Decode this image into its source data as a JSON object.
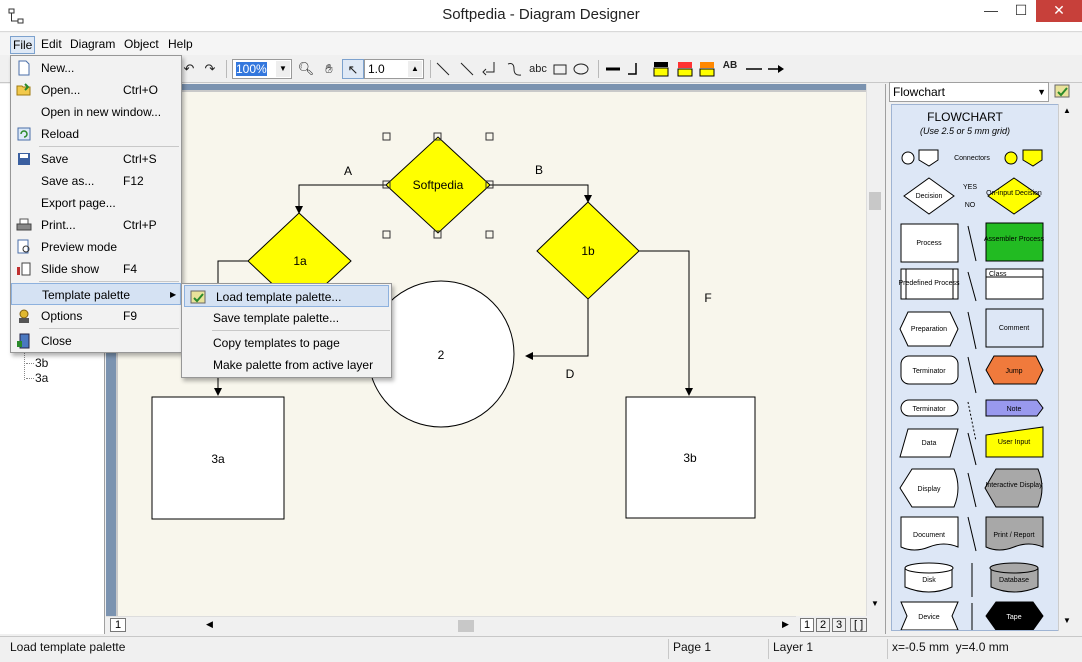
{
  "window": {
    "title": "Softpedia - Diagram Designer",
    "minimize_glyph": "—",
    "maximize_glyph": "☐",
    "close_glyph": "✕"
  },
  "menubar": {
    "items": [
      "File",
      "Edit",
      "Diagram",
      "Object",
      "Help"
    ]
  },
  "toolbar": {
    "zoom_value": "100%",
    "line_width_value": "1.0",
    "text_tool": "abc",
    "font_tool": "AB"
  },
  "file_menu": {
    "items": [
      {
        "label": "New...",
        "shortcut": "",
        "icon": "new-document-icon"
      },
      {
        "label": "Open...",
        "shortcut": "Ctrl+O",
        "icon": "open-folder-icon"
      },
      {
        "label": "Open in new window...",
        "shortcut": "",
        "icon": ""
      },
      {
        "label": "Reload",
        "shortcut": "",
        "icon": "reload-icon"
      },
      {
        "label": "Save",
        "shortcut": "Ctrl+S",
        "icon": "save-icon"
      },
      {
        "label": "Save as...",
        "shortcut": "F12",
        "icon": ""
      },
      {
        "label": "Export page...",
        "shortcut": "",
        "icon": ""
      },
      {
        "label": "Print...",
        "shortcut": "Ctrl+P",
        "icon": "print-icon"
      },
      {
        "label": "Preview mode",
        "shortcut": "",
        "icon": "preview-icon"
      },
      {
        "label": "Slide show",
        "shortcut": "F4",
        "icon": "slideshow-icon"
      },
      {
        "label": "Template palette",
        "shortcut": "",
        "icon": ""
      },
      {
        "label": "Options",
        "shortcut": "F9",
        "icon": "options-icon"
      },
      {
        "label": "Close",
        "shortcut": "",
        "icon": "close-door-icon"
      }
    ]
  },
  "submenu": {
    "items": [
      {
        "label": "Load template palette..."
      },
      {
        "label": "Save template palette..."
      },
      {
        "label": "Copy templates to page"
      },
      {
        "label": "Make palette from active layer"
      }
    ]
  },
  "left_panel": {
    "tree_items": [
      "3b",
      "3a"
    ]
  },
  "diagram": {
    "shapes": [
      "Softpedia",
      "1a",
      "1b",
      "2",
      "3a",
      "3b"
    ],
    "edge_labels": [
      "A",
      "B",
      "D",
      "F"
    ]
  },
  "palette": {
    "selected": "Flowchart",
    "title": "FLOWCHART",
    "subtitle": "(Use 2.5 or 5 mm grid)",
    "labels": {
      "connectors": "Connectors",
      "decision": "Decision",
      "yes": "YES",
      "no": "NO",
      "on_input_decision": "On-input Decision",
      "process": "Process",
      "assembler_process": "Assembler Process",
      "predefined_process": "Predefined Process",
      "class": "Class",
      "preparation": "Preparation",
      "comment": "Comment",
      "terminator": "Terminator",
      "jump": "Jump",
      "terminator2": "Terminator",
      "note": "Note",
      "data": "Data",
      "user_input": "User Input",
      "display": "Display",
      "interactive_display": "Interactive Display",
      "document": "Document",
      "print_report": "Print / Report",
      "disk": "Disk",
      "database": "Database",
      "device": "Device",
      "tape": "Tape"
    },
    "colors": {
      "yellow": "#ffff00",
      "green": "#22bb22",
      "orange": "#f07a3c",
      "blue": "#9999ee",
      "gray": "#a8a8a8",
      "black": "#000000"
    }
  },
  "page_tabs": [
    "1",
    "2",
    "3",
    "[ ]"
  ],
  "left_tab": "1",
  "status": {
    "message": "Load template palette",
    "page": "Page 1",
    "layer": "Layer 1",
    "coords": "x=-0.5 mm  y=4.0 mm"
  }
}
